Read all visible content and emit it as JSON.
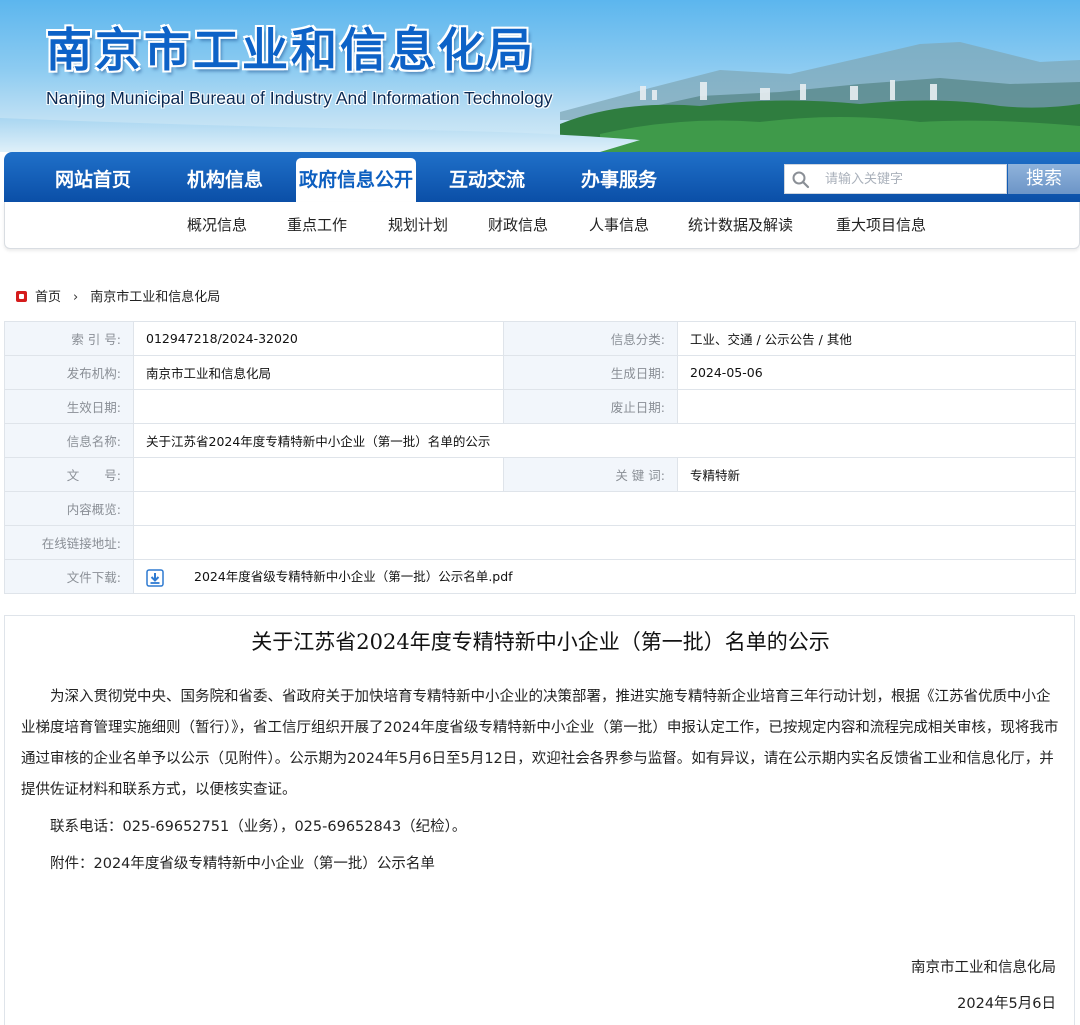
{
  "header": {
    "site_title": "南京市工业和信息化局",
    "site_subtitle": "Nanjing Municipal Bureau of Industry And Information Technology"
  },
  "nav": {
    "items": [
      {
        "label": "网站首页"
      },
      {
        "label": "机构信息"
      },
      {
        "label": "政府信息公开",
        "active": true
      },
      {
        "label": "互动交流"
      },
      {
        "label": "办事服务"
      }
    ],
    "search": {
      "placeholder": "请输入关键字",
      "button": "搜索",
      "icon": "search-icon"
    }
  },
  "subnav": {
    "items": [
      "概况信息",
      "重点工作",
      "规划计划",
      "财政信息",
      "人事信息",
      "统计数据及解读",
      "重大项目信息"
    ]
  },
  "breadcrumb": {
    "home": "首页",
    "separator": "›",
    "current": "南京市工业和信息化局"
  },
  "info": {
    "index_label": "索 引 号:",
    "index_value": "012947218/2024-32020",
    "category_label": "信息分类:",
    "category_value": "工业、交通 / 公示公告 / 其他",
    "publisher_label": "发布机构:",
    "publisher_value": "南京市工业和信息化局",
    "created_label": "生成日期:",
    "created_value": "2024-05-06",
    "effective_label": "生效日期:",
    "effective_value": "",
    "abolished_label": "废止日期:",
    "abolished_value": "",
    "name_label": "信息名称:",
    "name_value": "关于江苏省2024年度专精特新中小企业（第一批）名单的公示",
    "docno_label": "文　　号:",
    "docno_value": "",
    "keywords_label": "关 键 词:",
    "keywords_value": "专精特新",
    "summary_label": "内容概览:",
    "summary_value": "",
    "link_label": "在线链接地址:",
    "link_value": "",
    "download_label": "文件下载:",
    "download_file": "2024年度省级专精特新中小企业（第一批）公示名单.pdf"
  },
  "article": {
    "title": "关于江苏省2024年度专精特新中小企业（第一批）名单的公示",
    "paragraphs": [
      "为深入贯彻党中央、国务院和省委、省政府关于加快培育专精特新中小企业的决策部署，推进实施专精特新企业培育三年行动计划，根据《江苏省优质中小企业梯度培育管理实施细则（暂行）》，省工信厅组织开展了2024年度省级专精特新中小企业（第一批）申报认定工作，已按规定内容和流程完成相关审核，现将我市通过审核的企业名单予以公示（见附件）。公示期为2024年5月6日至5月12日，欢迎社会各界参与监督。如有异议，请在公示期内实名反馈省工业和信息化厅，并提供佐证材料和联系方式，以便核实查证。",
      "联系电话：025-69652751（业务），025-69652843（纪检）。",
      "附件：2024年度省级专精特新中小企业（第一批）公示名单"
    ],
    "signature": "南京市工业和信息化局",
    "date": "2024年5月6日"
  },
  "colors": {
    "title_blue": "#0d62c7",
    "nav_blue": "#0b4fa7",
    "label_bg": "#f2f6fb",
    "breadcrumb_red": "#d51c1c"
  }
}
